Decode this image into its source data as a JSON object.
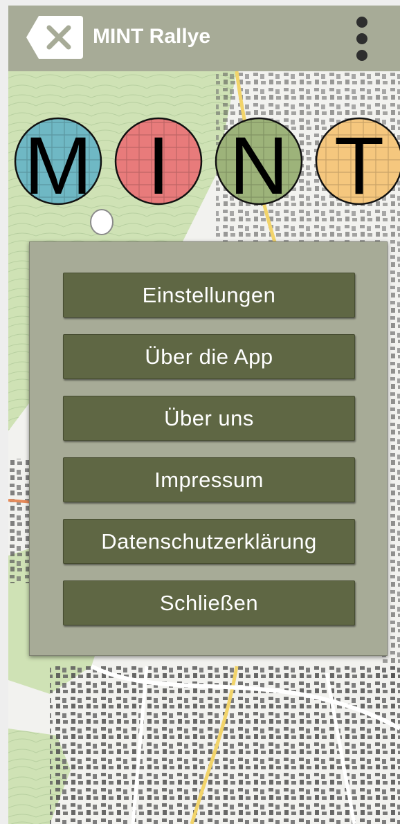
{
  "app_bar": {
    "title": "MINT Rallye",
    "back_icon": "close-icon",
    "menu_icon": "more-vert-icon",
    "background_color": "#a7ab97"
  },
  "logo": {
    "letters": [
      {
        "letter": "M",
        "color": "#6fb8c4"
      },
      {
        "letter": "I",
        "color": "#e87b7b"
      },
      {
        "letter": "N",
        "color": "#9db37a"
      },
      {
        "letter": "T",
        "color": "#f5c77e"
      }
    ]
  },
  "menu": {
    "items": [
      {
        "label": "Einstellungen"
      },
      {
        "label": "Über die App"
      },
      {
        "label": "Über uns"
      },
      {
        "label": "Impressum"
      },
      {
        "label": "Datenschutzerklärung"
      },
      {
        "label": "Schließen"
      }
    ],
    "button_color": "#5f6744",
    "panel_color": "#a7ab97"
  }
}
